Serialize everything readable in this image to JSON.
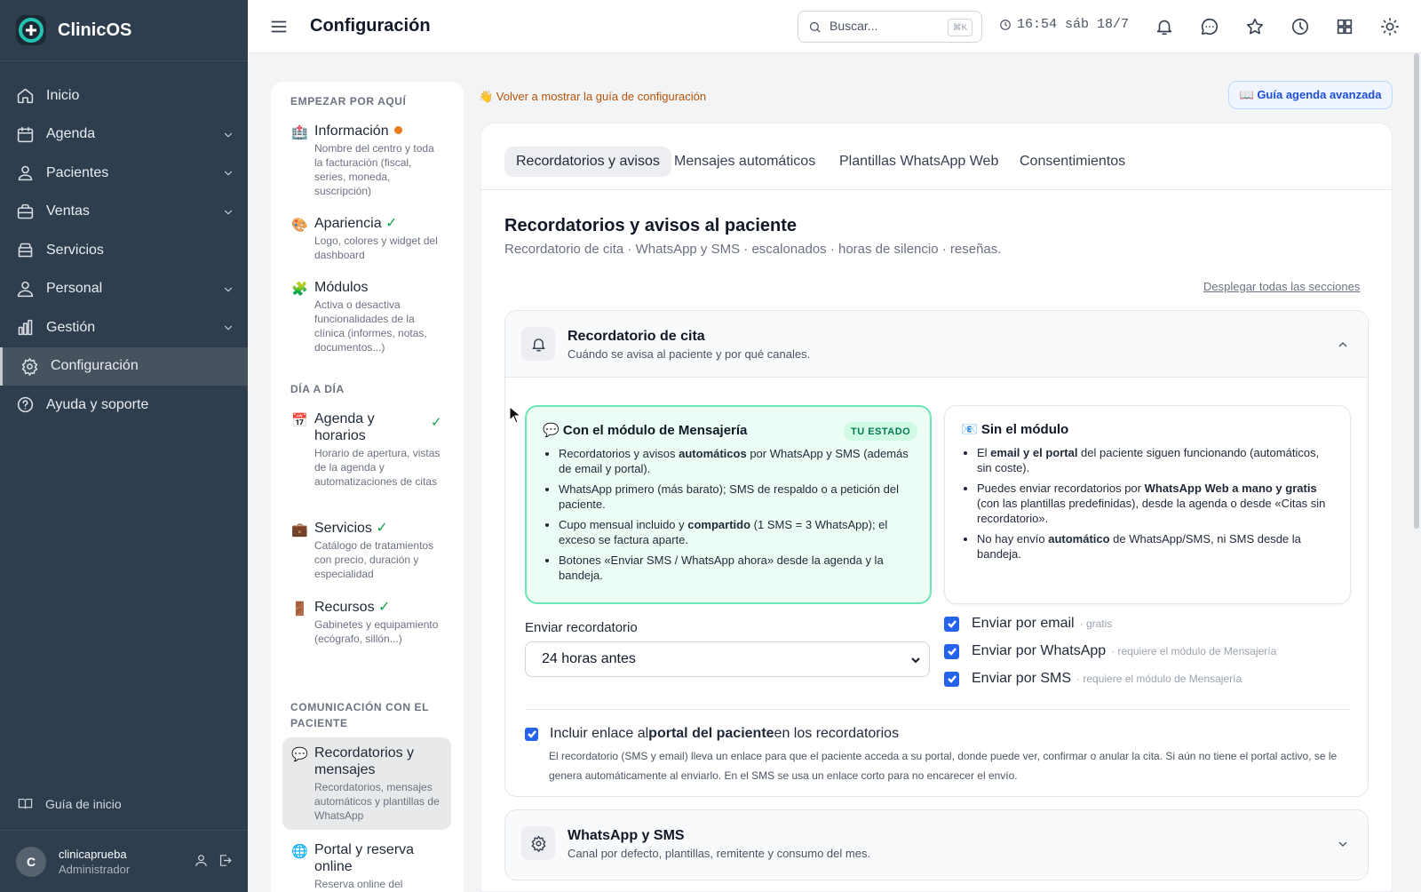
{
  "app": {
    "name": "ClinicOS"
  },
  "sidebar": {
    "items": [
      {
        "label": "Inicio",
        "icon": "home-icon"
      },
      {
        "label": "Agenda",
        "icon": "calendar-icon"
      },
      {
        "label": "Pacientes",
        "icon": "users-icon"
      },
      {
        "label": "Ventas",
        "icon": "briefcase-icon"
      },
      {
        "label": "Servicios",
        "icon": "box-icon"
      },
      {
        "label": "Personal",
        "icon": "staff-icon"
      },
      {
        "label": "Gestión",
        "icon": "bar-chart-icon"
      },
      {
        "label": "Configuración",
        "icon": "gear-icon",
        "active": true
      },
      {
        "label": "Ayuda y soporte",
        "icon": "help-icon"
      }
    ],
    "guide_label": "Guía de inicio",
    "user": {
      "initial": "C",
      "name": "clinicaprueba",
      "role": "Administrador"
    }
  },
  "topbar": {
    "title": "Configuración",
    "search_placeholder": "Buscar...",
    "shortcut": "⌘K",
    "clock": "16:54 sáb 18/7"
  },
  "settings_nav": {
    "sections": [
      {
        "heading": "EMPEZAR POR AQUÍ",
        "items": [
          {
            "icon": "🏥",
            "title": "Información",
            "desc": "Nombre del centro y toda la facturación (fiscal, series, moneda, suscripción)"
          },
          {
            "icon": "🎨",
            "title": "Apariencia",
            "desc": "Logo, colores y widget del dashboard"
          },
          {
            "icon": "🧩",
            "title": "Módulos",
            "desc": "Activa o desactiva funcionalidades de la clínica (informes, notas, documentos...)"
          }
        ]
      },
      {
        "heading": "DÍA A DÍA",
        "items": [
          {
            "icon": "📅",
            "title": "Agenda y horarios",
            "desc": "Horario de apertura, vistas de la agenda y automatizaciones de citas"
          },
          {
            "icon": "💼",
            "title": "Servicios",
            "desc": "Catálogo de tratamientos con precio, duración y especialidad"
          },
          {
            "icon": "🚪",
            "title": "Recursos",
            "desc": "Gabinetes y equipamiento (ecógrafo, sillón...)"
          }
        ]
      },
      {
        "heading": "COMUNICACIÓN CON EL PACIENTE",
        "items": [
          {
            "icon": "💬",
            "title": "Recordatorios y mensajes",
            "desc": "Recordatorios, mensajes automáticos y plantillas de WhatsApp"
          },
          {
            "icon": "🌐",
            "title": "Portal y reserva online",
            "desc": "Reserva online del"
          }
        ]
      }
    ],
    "check": "✓"
  },
  "reshow_guide": "👋 Volver a mostrar la guía de configuración",
  "advanced_guide": "📖 Guía agenda avanzada",
  "tabs": [
    "Recordatorios y avisos",
    "Mensajes automáticos",
    "Plantillas WhatsApp Web",
    "Consentimientos"
  ],
  "main": {
    "title": "Recordatorios y avisos al paciente",
    "subtitle": "Recordatorio de cita · WhatsApp y SMS · escalonados · horas de silencio · reseñas.",
    "expand_all": "Desplegar todas las secciones",
    "reminder": {
      "title": "Recordatorio de cita",
      "subtitle": "Cuándo se avisa al paciente y por qué canales.",
      "with_module": {
        "icon": "💬",
        "title": "Con el módulo de Mensajería",
        "badge": "TU ESTADO",
        "bullets": [
          [
            "Recordatorios y avisos ",
            "automáticos",
            " por WhatsApp y SMS (además de email y portal)."
          ],
          [
            "WhatsApp primero (más barato); SMS de respaldo o a petición del paciente."
          ],
          [
            "Cupo mensual incluido y ",
            "compartido",
            " (1 SMS = 3 WhatsApp); el exceso se factura aparte."
          ],
          [
            "Botones «Enviar SMS / WhatsApp ahora» desde la agenda y la bandeja."
          ]
        ]
      },
      "without_module": {
        "icon": "📧",
        "title": "Sin el módulo",
        "bullets": [
          [
            "El ",
            "email y el portal",
            " del paciente siguen funcionando (automáticos, sin coste)."
          ],
          [
            "Puedes enviar recordatorios por ",
            "WhatsApp Web a mano y gratis",
            " (con las plantillas predefinidas), desde la agenda o desde «Citas sin recordatorio»."
          ],
          [
            "No hay envío ",
            "automático",
            " de WhatsApp/SMS, ni SMS desde la bandeja."
          ]
        ]
      },
      "send_label": "Enviar recordatorio",
      "send_value": "24 horas antes",
      "channels": [
        {
          "label": "Enviar por email",
          "note": "· gratis",
          "checked": true
        },
        {
          "label": "Enviar por WhatsApp",
          "note": "· requiere el módulo de Mensajería",
          "checked": true
        },
        {
          "label": "Enviar por SMS",
          "note": "· requiere el módulo de Mensajería",
          "checked": true
        }
      ],
      "portal_option": {
        "pre": "Incluir enlace al ",
        "bold": "portal del paciente",
        "post": " en los recordatorios",
        "checked": true
      },
      "portal_desc": "El recordatorio (SMS y email) lleva un enlace para que el paciente acceda a su portal, donde puede ver, confirmar o anular la cita. Si aún no tiene el portal activo, se le genera automáticamente al enviarlo. En el SMS se usa un enlace corto para no encarecer el envío."
    },
    "whatsapp_sms": {
      "title": "WhatsApp y SMS",
      "subtitle": "Canal por defecto, plantillas, remitente y consumo del mes."
    }
  },
  "colors": {
    "sidebar": "#2f3e4e",
    "accent": "#2563eb",
    "success": "#16a34a",
    "warning": "#b45309"
  }
}
